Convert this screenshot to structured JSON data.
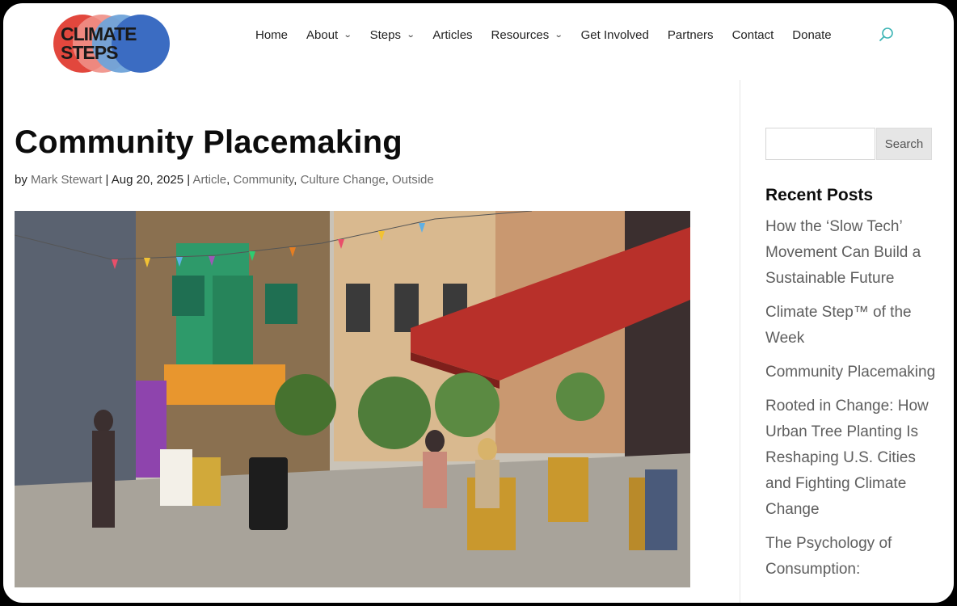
{
  "logo": {
    "line1": "CLIMATE",
    "line2": "STEPS"
  },
  "nav": {
    "items": [
      {
        "label": "Home",
        "has_dropdown": false
      },
      {
        "label": "About",
        "has_dropdown": true
      },
      {
        "label": "Steps",
        "has_dropdown": true
      },
      {
        "label": "Articles",
        "has_dropdown": false
      },
      {
        "label": "Resources",
        "has_dropdown": true
      },
      {
        "label": "Get Involved",
        "has_dropdown": false
      },
      {
        "label": "Partners",
        "has_dropdown": false
      },
      {
        "label": "Contact",
        "has_dropdown": false
      },
      {
        "label": "Donate",
        "has_dropdown": false
      }
    ],
    "search_icon": "search-icon"
  },
  "post": {
    "title": "Community Placemaking",
    "by": "by",
    "author": "Mark Stewart",
    "date": "Aug 20, 2025",
    "categories": [
      "Article",
      "Community",
      "Culture Change",
      "Outside"
    ]
  },
  "sidebar": {
    "search_placeholder": "",
    "search_button": "Search",
    "recent_title": "Recent Posts",
    "recent_posts": [
      "How the ‘Slow Tech’ Movement Can Build a Sustainable Future",
      "Climate Step™ of the Week",
      "Community Placemaking",
      "Rooted in Change: How Urban Tree Planting Is Reshaping U.S. Cities and Fighting Climate Change",
      "The Psychology of Consumption:"
    ]
  },
  "colors": {
    "accent": "#3bb4b4",
    "link_gray": "#6b6b6b",
    "awning": "#b8302a"
  }
}
